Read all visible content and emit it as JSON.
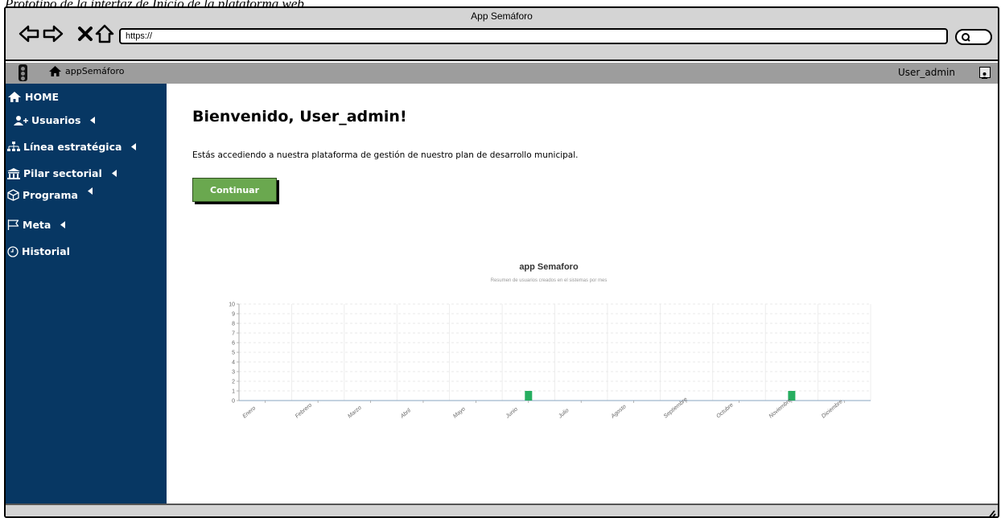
{
  "caption": "Prototipo de la interfaz de Inicio de la plataforma web",
  "window": {
    "title": "App Semáforo",
    "url": "https://"
  },
  "appbar": {
    "brand": "appSemáforo",
    "user": "User_admin"
  },
  "sidebar": {
    "items": [
      {
        "label": "HOME",
        "icon": "home-icon",
        "has_caret": false
      },
      {
        "label": "Usuarios",
        "icon": "add-user-icon",
        "has_caret": true
      },
      {
        "label": "Línea estratégica",
        "icon": "sitemap-icon",
        "has_caret": true
      },
      {
        "label": "Pilar sectorial",
        "icon": "institution-icon",
        "has_caret": true
      },
      {
        "label": "Programa",
        "icon": "cube-icon",
        "has_caret": true
      },
      {
        "label": "Meta",
        "icon": "flag-icon",
        "has_caret": true
      },
      {
        "label": "Historial",
        "icon": "clock-icon",
        "has_caret": false
      }
    ]
  },
  "main": {
    "welcome": "Bienvenido, User_admin!",
    "description": "Estás accediendo a nuestra plataforma de gestión de nuestro plan de desarrollo municipal.",
    "continue_label": "Continuar"
  },
  "colors": {
    "sidebar": "#073763",
    "continue": "#6aa84f",
    "bar": "#27ae60",
    "appbar": "#9d9d9d",
    "titlebar": "#d4d4d4"
  },
  "chart_data": {
    "type": "bar",
    "title": "app Semaforo",
    "subtitle": "Resumen de usuarios creados en el sistemas por mes",
    "categories": [
      "Enero",
      "Febrero",
      "Marzo",
      "Abril",
      "Mayo",
      "Junio",
      "Julio",
      "Agosto",
      "Septiembre",
      "Octubre",
      "Noviembre",
      "Diciembre"
    ],
    "values": [
      0,
      0,
      0,
      0,
      0,
      1,
      0,
      0,
      0,
      0,
      1,
      0
    ],
    "ylim": [
      0,
      10
    ],
    "yticks": [
      0,
      1,
      2,
      3,
      4,
      5,
      6,
      7,
      8,
      9,
      10
    ],
    "grid": true
  }
}
